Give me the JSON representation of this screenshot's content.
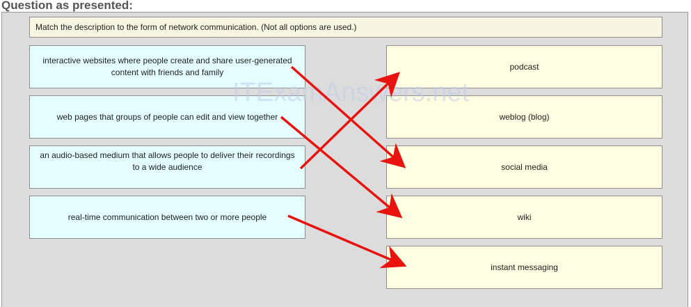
{
  "heading": "Question as presented:",
  "instruction": "Match the description to the form of network communication. (Not all options are used.)",
  "descriptions": [
    "interactive websites where people create and share user-generated content with friends and family",
    "web pages that groups of people can edit and view together",
    "an audio-based medium that allows people to deliver their recordings to a wide audience",
    "real-time communication between two or more people"
  ],
  "options": [
    "podcast",
    "weblog (blog)",
    "social media",
    "wiki",
    "instant messaging"
  ],
  "watermark": "ITExamAnswers.net",
  "colors": {
    "arrow": "#e8130f",
    "description_bg": "#e4fdff",
    "option_bg": "#fefee2",
    "panel_bg": "#dcdcdc"
  }
}
